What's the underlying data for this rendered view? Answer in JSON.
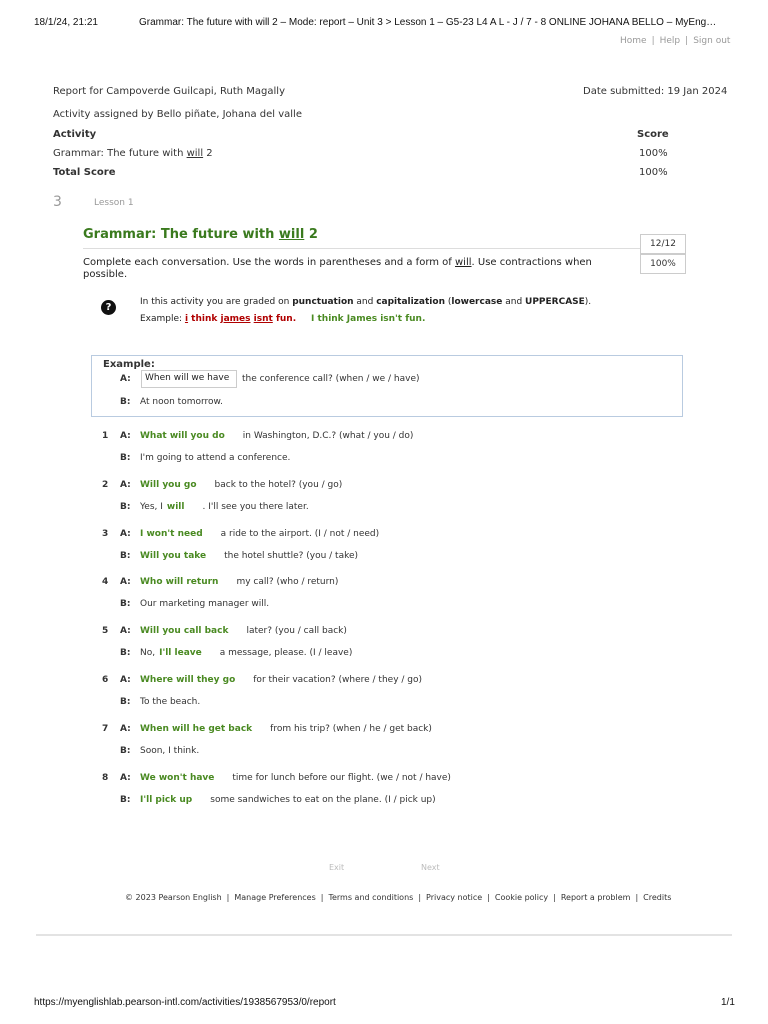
{
  "print_header": {
    "datetime": "18/1/24, 21:21",
    "page_title": "Grammar: The future with will 2 – Mode: report – Unit 3 > Lesson 1 – G5-23 L4 A L - J / 7 - 8 ONLINE JOHANA BELLO – MyEng…"
  },
  "top_links": {
    "home": "Home",
    "help": "Help",
    "sign_out": "Sign out",
    "sep": "|"
  },
  "report": {
    "report_for": "Report for Campoverde Guilcapi, Ruth Magally",
    "date_submitted": "Date submitted: 19 Jan 2024",
    "assigned_by": "Activity assigned by Bello piñate, Johana del valle",
    "col_activity": "Activity",
    "col_score": "Score",
    "activity_name_pre": "Grammar: The future with ",
    "activity_name_will": "will",
    "activity_name_post": " 2",
    "activity_score": "100%",
    "total_label": "Total Score",
    "total_score": "100%"
  },
  "lesson": {
    "number": "3",
    "label": "Lesson 1"
  },
  "activity": {
    "title_pre": "Grammar: The future with ",
    "title_will": "will",
    "title_post": " 2",
    "score_fraction": "12/12",
    "score_percent": "100%",
    "instr_pre": "Complete each conversation. Use the words in parentheses and a form of ",
    "instr_will": "will",
    "instr_post": ". Use contractions when possible."
  },
  "tip": {
    "help_glyph": "?",
    "line1_a": "In this activity you are graded on ",
    "line1_b": "punctuation",
    "line1_c": " and ",
    "line1_d": "capitalization",
    "line1_e": " (",
    "line1_f": "lowercase",
    "line1_g": " and ",
    "line1_h": "UPPERCASE",
    "line1_i": ").",
    "example_label": "Example: ",
    "wrong_i": "i",
    "wrong_think": " think ",
    "wrong_james": "james",
    "wrong_space": " ",
    "wrong_isnt": "isnt",
    "wrong_fun": " fun",
    "wrong_dot": ".",
    "correct": "I think James isn't fun."
  },
  "example": {
    "heading": "Example:",
    "a_label": "A:",
    "a_value": "When will we have",
    "a_rest": "the conference call? (when / we / have)",
    "b_label": "B:",
    "b_text": "At noon tomorrow."
  },
  "items": [
    {
      "num": "1",
      "a_label": "A:",
      "a_pre": "",
      "a_ans": "What will you do",
      "a_post": "in Washington, D.C.? (what / you / do)",
      "b_label": "B:",
      "b_pre": "I'm going to attend a conference.",
      "b_ans": "",
      "b_post": ""
    },
    {
      "num": "2",
      "a_label": "A:",
      "a_pre": "",
      "a_ans": "Will you go",
      "a_post": "back to the hotel? (you / go)",
      "b_label": "B:",
      "b_pre": "Yes, I",
      "b_ans": "will",
      "b_post": ". I'll see you there later."
    },
    {
      "num": "3",
      "a_label": "A:",
      "a_pre": "",
      "a_ans": "I won't need",
      "a_post": "a ride to the airport. (I / not / need)",
      "b_label": "B:",
      "b_pre": "",
      "b_ans": "Will you take",
      "b_post": "the hotel shuttle? (you / take)"
    },
    {
      "num": "4",
      "a_label": "A:",
      "a_pre": "",
      "a_ans": "Who will return",
      "a_post": "my call? (who / return)",
      "b_label": "B:",
      "b_pre": "Our marketing manager will.",
      "b_ans": "",
      "b_post": ""
    },
    {
      "num": "5",
      "a_label": "A:",
      "a_pre": "",
      "a_ans": "Will you call back",
      "a_post": "later? (you / call back)",
      "b_label": "B:",
      "b_pre": "No,",
      "b_ans": "I'll leave",
      "b_post": "a message, please. (I / leave)"
    },
    {
      "num": "6",
      "a_label": "A:",
      "a_pre": "",
      "a_ans": "Where will they go",
      "a_post": "for their vacation? (where / they / go)",
      "b_label": "B:",
      "b_pre": "To the beach.",
      "b_ans": "",
      "b_post": ""
    },
    {
      "num": "7",
      "a_label": "A:",
      "a_pre": "",
      "a_ans": "When will he get back",
      "a_post": "from his trip? (when / he / get back)",
      "b_label": "B:",
      "b_pre": "Soon, I think.",
      "b_ans": "",
      "b_post": ""
    },
    {
      "num": "8",
      "a_label": "A:",
      "a_pre": "",
      "a_ans": "We won't have",
      "a_post": "time for lunch before our flight. (we / not / have)",
      "b_label": "B:",
      "b_pre": "",
      "b_ans": "I'll pick up",
      "b_post": "some sandwiches to eat on the plane. (I / pick up)"
    }
  ],
  "nav": {
    "exit": "Exit",
    "next": "Next"
  },
  "footer": {
    "copyright": "© 2023 Pearson English",
    "manage": "Manage Preferences",
    "terms": "Terms and conditions",
    "privacy": "Privacy notice",
    "cookie": "Cookie policy",
    "report": "Report a problem",
    "credits": "Credits",
    "sep": "|"
  },
  "print_footer": {
    "url": "https://myenglishlab.pearson-intl.com/activities/1938567953/0/report",
    "page": "1/1"
  }
}
